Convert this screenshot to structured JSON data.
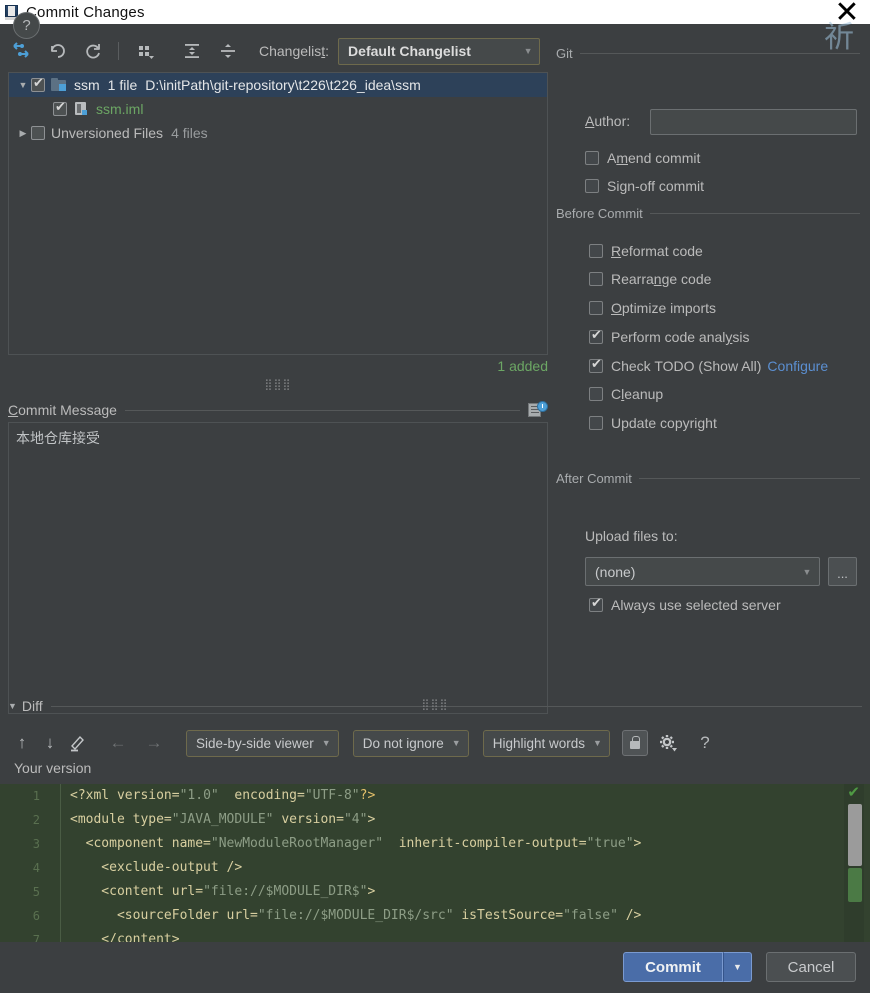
{
  "window": {
    "title": "Commit Changes",
    "app_icon": "idea-icon",
    "close_label": "✕"
  },
  "toolbar": {
    "buttons": [
      {
        "name": "show-diff-icon",
        "label": "Show Diff"
      },
      {
        "name": "revert-icon",
        "label": "Revert"
      },
      {
        "name": "refresh-icon",
        "label": "Refresh"
      },
      {
        "name": "group-by-icon",
        "label": "Group By"
      },
      {
        "name": "expand-all-icon",
        "label": "Expand All"
      },
      {
        "name": "collapse-all-icon",
        "label": "Collapse All"
      }
    ],
    "changelist_label": "Changelist:",
    "changelist_value": "Default Changelist"
  },
  "file_tree": {
    "rows": [
      {
        "indent": 0,
        "triangle": "▼",
        "checked": true,
        "icon": "folder-icon",
        "name": "ssm",
        "count": "1 file",
        "path": "D:\\initPath\\git-repository\\t226\\t226_idea\\ssm",
        "selected": true,
        "green": false
      },
      {
        "indent": 1,
        "triangle": "",
        "checked": true,
        "icon": "module-file-icon",
        "name": "ssm.iml",
        "count": "",
        "path": "",
        "selected": false,
        "green": true
      },
      {
        "indent": 0,
        "triangle": "▶",
        "checked": false,
        "icon": "",
        "name": "Unversioned Files",
        "count": "4 files",
        "path": "",
        "selected": false,
        "green": false
      }
    ],
    "added_note": "1 added"
  },
  "commit_message": {
    "label": "Commit Message",
    "label_mnemonic": "C",
    "label_rest": "ommit Message",
    "history_icon": "commit-history-icon",
    "value": "本地仓库接受"
  },
  "git_group": {
    "title": "Git",
    "author_label": "Author:",
    "author_mnemonic": "A",
    "author_rest": "uthor:",
    "author_value": "",
    "author_placeholder": "",
    "options": [
      {
        "label": "Amend commit",
        "checked": false,
        "mnemonic_index": 2
      },
      {
        "label": "Sign-off commit",
        "checked": false,
        "mnemonic_index": -1
      }
    ]
  },
  "before_commit": {
    "title": "Before Commit",
    "options": [
      {
        "label": "Reformat code",
        "checked": false
      },
      {
        "label": "Rearrange code",
        "checked": false
      },
      {
        "label": "Optimize imports",
        "checked": false
      },
      {
        "label": "Perform code analysis",
        "checked": true
      },
      {
        "label": "Check TODO (Show All)",
        "checked": true,
        "link": "Configure"
      },
      {
        "label": "Cleanup",
        "checked": false
      },
      {
        "label": "Update copyright",
        "checked": false
      }
    ]
  },
  "after_commit": {
    "title": "After Commit",
    "upload_label": "Upload files to:",
    "upload_value": "(none)",
    "browse_label": "...",
    "always_use_label": "Always use selected server",
    "always_use_checked": true
  },
  "diff": {
    "section_label": "Diff",
    "section_triangle": "▼",
    "nav_buttons": [
      {
        "name": "previous-difference-icon",
        "glyph": "↑",
        "dim": false
      },
      {
        "name": "next-difference-icon",
        "glyph": "↓",
        "dim": false
      },
      {
        "name": "edit-source-icon",
        "glyph": "✎",
        "dim": false
      },
      {
        "name": "previous-file-icon",
        "glyph": "←",
        "dim": true
      },
      {
        "name": "next-file-icon",
        "glyph": "→",
        "dim": true
      }
    ],
    "viewer_mode": "Side-by-side viewer",
    "ignore_mode": "Do not ignore",
    "highlight_mode": "Highlight words",
    "lock_icon": "lock-icon",
    "settings_icon": "gear-icon",
    "help_icon": "question-icon",
    "pane_title": "Your version",
    "code_lines": [
      {
        "number": "1",
        "tokens": [
          {
            "t": "tg",
            "s": "<?xml "
          },
          {
            "t": "at",
            "s": "version="
          },
          {
            "t": "vl",
            "s": "\"1.0\""
          },
          {
            "t": "at",
            "s": "  encoding="
          },
          {
            "t": "vl",
            "s": "\"UTF-8\""
          },
          {
            "t": "pn",
            "s": "?>"
          }
        ]
      },
      {
        "number": "2",
        "tokens": [
          {
            "t": "tg",
            "s": "<module "
          },
          {
            "t": "at",
            "s": "type="
          },
          {
            "t": "vl",
            "s": "\"JAVA_MODULE\""
          },
          {
            "t": "at",
            "s": " version="
          },
          {
            "t": "vl",
            "s": "\"4\""
          },
          {
            "t": "tg",
            "s": ">"
          }
        ]
      },
      {
        "number": "3",
        "tokens": [
          {
            "t": "tg",
            "s": "  <component "
          },
          {
            "t": "at",
            "s": "name="
          },
          {
            "t": "vl",
            "s": "\"NewModuleRootManager\""
          },
          {
            "t": "at",
            "s": "  inherit-compiler-output="
          },
          {
            "t": "vl",
            "s": "\"true\""
          },
          {
            "t": "tg",
            "s": ">"
          }
        ]
      },
      {
        "number": "4",
        "tokens": [
          {
            "t": "tg",
            "s": "    <exclude-output />"
          }
        ]
      },
      {
        "number": "5",
        "tokens": [
          {
            "t": "tg",
            "s": "    <content "
          },
          {
            "t": "at",
            "s": "url="
          },
          {
            "t": "vl",
            "s": "\"file://$MODULE_DIR$\""
          },
          {
            "t": "tg",
            "s": ">"
          }
        ]
      },
      {
        "number": "6",
        "tokens": [
          {
            "t": "tg",
            "s": "      <sourceFolder "
          },
          {
            "t": "at",
            "s": "url="
          },
          {
            "t": "vl",
            "s": "\"file://$MODULE_DIR$/src\""
          },
          {
            "t": "at",
            "s": " isTestSource="
          },
          {
            "t": "vl",
            "s": "\"false\""
          },
          {
            "t": "tg",
            "s": " />"
          }
        ]
      },
      {
        "number": "7",
        "tokens": [
          {
            "t": "tg",
            "s": "    </content>"
          }
        ]
      }
    ]
  },
  "footer": {
    "help_label": "?",
    "commit_label": "Commit",
    "commit_arrow": "▼",
    "cancel_label": "Cancel"
  },
  "colors": {
    "background": "#3c3f41",
    "selection": "#2d4159",
    "accent_blue": "#4a6da8",
    "link": "#5b8fd1",
    "added_green": "#6ca664",
    "diff_green_bg": "#33422f"
  }
}
